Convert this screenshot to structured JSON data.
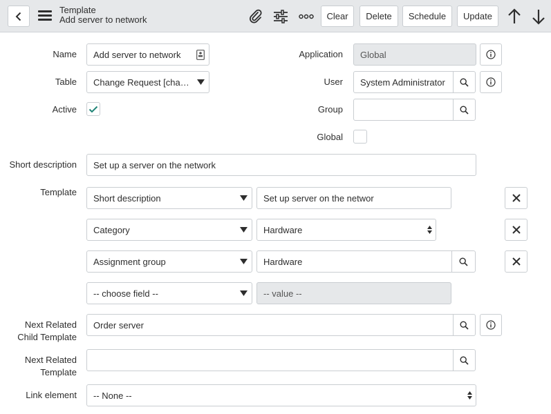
{
  "header": {
    "title": "Template",
    "subtitle": "Add server to network",
    "buttons": {
      "clear": "Clear",
      "delete": "Delete",
      "schedule": "Schedule",
      "update": "Update"
    },
    "icons": [
      "back-icon",
      "menu-icon",
      "attachment-icon",
      "settings-sliders-icon",
      "more-icon",
      "arrow-up-icon",
      "arrow-down-icon"
    ]
  },
  "form": {
    "name": {
      "label": "Name",
      "value": "Add server to network"
    },
    "table": {
      "label": "Table",
      "value": "Change Request [chang…"
    },
    "active": {
      "label": "Active",
      "checked": true
    },
    "application": {
      "label": "Application",
      "value": "Global"
    },
    "user": {
      "label": "User",
      "value": "System Administrator"
    },
    "group": {
      "label": "Group",
      "value": ""
    },
    "global": {
      "label": "Global",
      "checked": false
    },
    "short_description": {
      "label": "Short description",
      "value": "Set up a server on the network"
    },
    "template": {
      "label": "Template",
      "rows": [
        {
          "field": "Short description",
          "value": "Set up server on the networ"
        },
        {
          "field": "Category",
          "value": "Hardware"
        },
        {
          "field": "Assignment group",
          "value": "Hardware"
        },
        {
          "field": "-- choose field --",
          "value": "-- value --"
        }
      ]
    },
    "next_related_child_template": {
      "label_line1": "Next Related",
      "label_line2": "Child Template",
      "value": "Order server"
    },
    "next_related_template": {
      "label_line1": "Next Related",
      "label_line2": "Template",
      "value": ""
    },
    "link_element": {
      "label": "Link element",
      "value": "-- None --"
    }
  },
  "colors": {
    "header_bg": "#e6e8ea",
    "check_accent": "#1f8476",
    "border": "#c9cdd1",
    "readonly_bg": "#e6e8ea"
  }
}
